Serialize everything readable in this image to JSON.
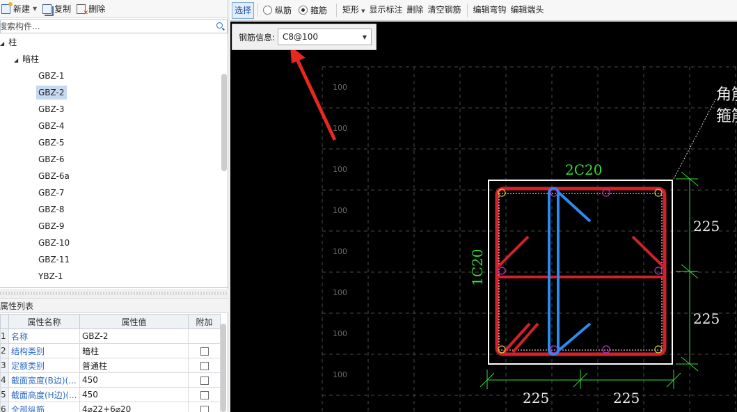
{
  "left_toolbar": {
    "new_label": "新建",
    "copy_label": "复制",
    "delete_label": "删除"
  },
  "search": {
    "placeholder": "搜索构件..."
  },
  "tree": {
    "root": "柱",
    "group": "暗柱",
    "items": [
      "GBZ-1",
      "GBZ-2",
      "GBZ-3",
      "GBZ-4",
      "GBZ-5",
      "GBZ-6",
      "GBZ-6a",
      "GBZ-7",
      "GBZ-8",
      "GBZ-9",
      "GBZ-10",
      "GBZ-11",
      "YBZ-1"
    ],
    "selected": "GBZ-2"
  },
  "properties": {
    "title": "属性列表",
    "headers": [
      "属性名称",
      "属性值",
      "附加"
    ],
    "rows": [
      {
        "num": "1",
        "name": "名称",
        "value": "GBZ-2"
      },
      {
        "num": "2",
        "name": "结构类别",
        "value": "暗柱"
      },
      {
        "num": "3",
        "name": "定额类别",
        "value": "普通柱"
      },
      {
        "num": "4",
        "name": "截面宽度(B边)(...",
        "value": "450"
      },
      {
        "num": "5",
        "name": "截面高度(H边)(...",
        "value": "450"
      },
      {
        "num": "6",
        "name": "全部纵筋",
        "value": "4⌀22+6⌀20"
      }
    ]
  },
  "right_toolbar": {
    "select": "选择",
    "longitudinal": "纵筋",
    "stirrup": "箍筋",
    "rect": "矩形",
    "show_label": "显示标注",
    "delete": "删除",
    "clear": "清空钢筋",
    "edit_hook": "编辑弯钩",
    "edit_end": "编辑端头"
  },
  "rebar_info": {
    "label": "钢筋信息:",
    "value": "C8@100"
  },
  "drawing": {
    "grid_labels": [
      "100",
      "100",
      "100",
      "100",
      "100",
      "100",
      "100",
      "100"
    ],
    "top_label": "2C20",
    "side_label": "1C20",
    "dims_right": [
      "225",
      "225"
    ],
    "dims_bottom": [
      "225",
      "225"
    ],
    "corner_note_1": "角筋",
    "corner_note_2": "箍筋",
    "colors": {
      "outer_stirrup": "#d4202a",
      "tie": "#2a8bf0",
      "dimension": "#33dd33",
      "label_green": "#33dd33"
    }
  }
}
